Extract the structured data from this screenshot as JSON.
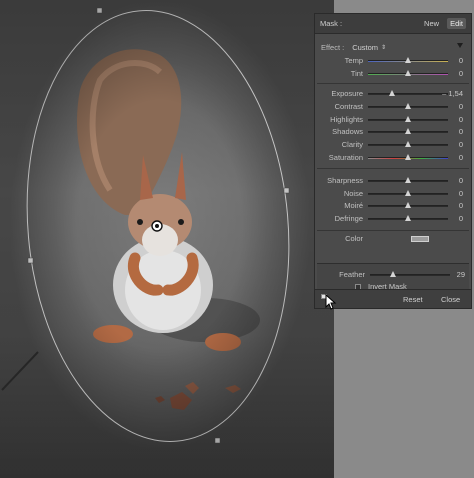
{
  "header": {
    "title": "Mask :",
    "new_label": "New",
    "edit_label": "Edit"
  },
  "effect": {
    "label": "Effect :",
    "value": "Custom"
  },
  "sliders_group1": [
    {
      "label": "Temp",
      "value": "0",
      "level": 0.5,
      "track": "temp"
    },
    {
      "label": "Tint",
      "value": "0",
      "level": 0.5,
      "track": "tint"
    }
  ],
  "sliders_group2": [
    {
      "label": "Exposure",
      "value": "– 1,54",
      "level": 0.3,
      "track": "plain"
    },
    {
      "label": "Contrast",
      "value": "0",
      "level": 0.5,
      "track": "plain"
    },
    {
      "label": "Highlights",
      "value": "0",
      "level": 0.5,
      "track": "plain"
    },
    {
      "label": "Shadows",
      "value": "0",
      "level": 0.5,
      "track": "plain"
    },
    {
      "label": "Clarity",
      "value": "0",
      "level": 0.5,
      "track": "plain"
    },
    {
      "label": "Saturation",
      "value": "0",
      "level": 0.5,
      "track": "sat"
    }
  ],
  "sliders_group3": [
    {
      "label": "Sharpness",
      "value": "0",
      "level": 0.5,
      "track": "plain"
    },
    {
      "label": "Noise",
      "value": "0",
      "level": 0.5,
      "track": "plain"
    },
    {
      "label": "Moiré",
      "value": "0",
      "level": 0.5,
      "track": "plain"
    },
    {
      "label": "Defringe",
      "value": "0",
      "level": 0.5,
      "track": "plain"
    }
  ],
  "color": {
    "label": "Color"
  },
  "feather": {
    "label": "Feather",
    "value": "29",
    "level": 0.29
  },
  "invert_mask": {
    "label": "Invert Mask",
    "checked": false
  },
  "footer": {
    "reset_label": "Reset",
    "close_label": "Close"
  },
  "colors": {
    "panel_bg": "#4b4b4b",
    "header_bg": "#3d3d3d",
    "text": "#c8c8c8"
  }
}
